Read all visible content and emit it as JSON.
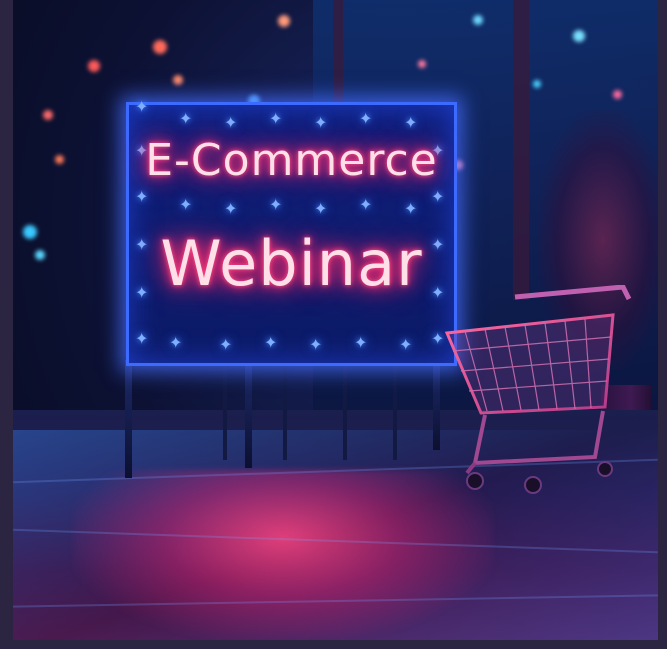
{
  "image": {
    "description_free": true
  },
  "sign": {
    "line1": "E-Commerce",
    "line2": "Webinar",
    "neon_color": "#ff2f72",
    "frame_color": "#3d6bff"
  },
  "palette": {
    "background_border": "#2b2541",
    "ambient_blue": "#1b2a6a",
    "reflection_pink": "#ff4682"
  },
  "objects": {
    "shopping_cart_icon": "shopping-cart-icon"
  }
}
